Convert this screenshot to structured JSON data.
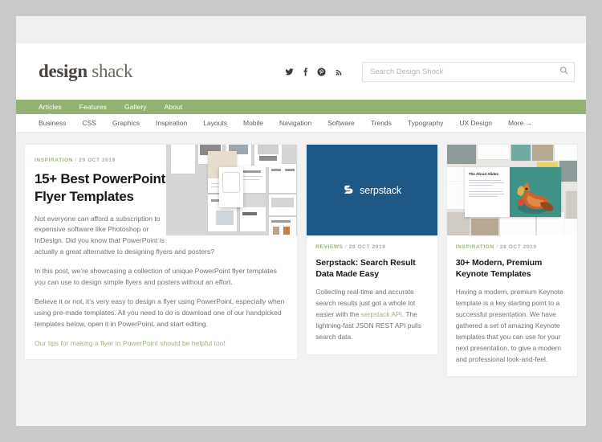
{
  "site": {
    "logo_bold": "design",
    "logo_light": "shack"
  },
  "social": [
    {
      "name": "twitter-icon",
      "label": "Twitter"
    },
    {
      "name": "facebook-icon",
      "label": "Facebook"
    },
    {
      "name": "pinterest-icon",
      "label": "Pinterest"
    },
    {
      "name": "rss-icon",
      "label": "RSS"
    }
  ],
  "search": {
    "placeholder": "Search Design Shock",
    "value": "",
    "icon": "search-icon"
  },
  "nav_primary": [
    {
      "label": "Articles",
      "active": true
    },
    {
      "label": "Features",
      "active": false
    },
    {
      "label": "Gallery",
      "active": false
    },
    {
      "label": "About",
      "active": false
    }
  ],
  "nav_secondary": [
    {
      "label": "Business"
    },
    {
      "label": "CSS"
    },
    {
      "label": "Graphics"
    },
    {
      "label": "Inspiration"
    },
    {
      "label": "Layouts"
    },
    {
      "label": "Mobile"
    },
    {
      "label": "Navigation"
    },
    {
      "label": "Software"
    },
    {
      "label": "Trends"
    },
    {
      "label": "Typography"
    },
    {
      "label": "UX Design"
    },
    {
      "label": "More →"
    }
  ],
  "featured": {
    "category": "INSPIRATION",
    "separator": "/",
    "date": "29 OCT 2019",
    "title": "15+ Best PowerPoint Flyer Templates",
    "p1": "Not everyone can afford a subscription to expensive software like Photoshop or InDesign. Did you know that PowerPoint is actually a great alternative to designing flyers and posters?",
    "p2": "In this post, we’re showcasing a collection of unique PowerPoint flyer templates you can use to design simple flyers and posters without an effort.",
    "p3": "Believe it or not, it’s very easy to design a flyer using PowerPoint, especially when using pre-made templates. All you need to do is download one of our handpicked templates below, open it in PowerPoint, and start editing.",
    "link_text": "Our tips for making a flyer in PowerPoint should be helpful too!",
    "thumb_alt": "powerpoint-flyer-templates-grid"
  },
  "cards": [
    {
      "category": "REVIEWS",
      "separator": "/",
      "date": "28 OCT 2019",
      "title": "Serpstack: Search Result Data Made Easy",
      "excerpt_before": "Collecting real-time and accurate search results just got a whole lot easier with the ",
      "excerpt_link": "serpstack API",
      "excerpt_after": ". The lightning-fast JSON REST API pulls search data.",
      "thumb_type": "serpstack-logo-tile",
      "thumb_logo_text": "serpstack",
      "thumb_bg": "#1d5886"
    },
    {
      "category": "INSPIRATION",
      "separator": "/",
      "date": "28 OCT 2019",
      "title": "30+ Modern, Premium Keynote Templates",
      "excerpt": "Having a modern, premium Keynote template is a key starting point to a successful presentation. We have gathered a set of amazing Keynote templates that you can use for your next presentation, to give a modern and professional look-and-feel.",
      "thumb_type": "keynote-template-collage",
      "thumb_front_title": "The About Slides"
    }
  ],
  "theme": {
    "green": "#93b173",
    "link_green": "#9bb47e",
    "text_dark": "#16191c",
    "text_body": "#6f7277",
    "page_border": "#c9c9c9"
  }
}
